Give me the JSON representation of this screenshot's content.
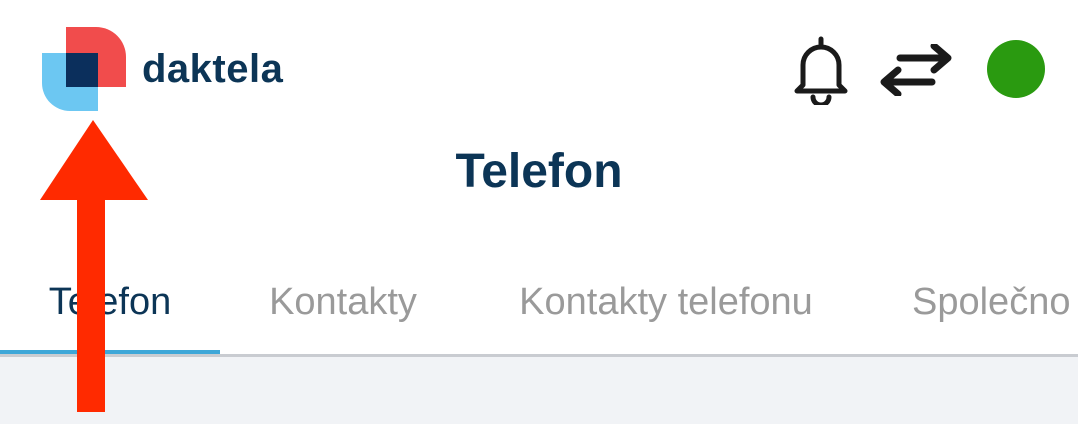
{
  "header": {
    "logo_text": "daktela",
    "icons": {
      "logo": "daktela-logo-icon",
      "notifications": "bell-icon",
      "switch": "swap-arrows-icon",
      "status": "status-online-dot"
    }
  },
  "page": {
    "title": "Telefon"
  },
  "tabs": [
    {
      "label": "Telefon",
      "active": true
    },
    {
      "label": "Kontakty",
      "active": false
    },
    {
      "label": "Kontakty telefonu",
      "active": false
    },
    {
      "label": "Společno",
      "active": false
    }
  ],
  "annotation": {
    "type": "red-arrow-up"
  },
  "colors": {
    "brand_navy": "#0c3556",
    "logo_red": "#f14c4c",
    "logo_blue": "#6cc7f2",
    "logo_dark": "#0b2f5c",
    "tab_inactive": "#9a9a9a",
    "tab_underline": "#3ea7d8",
    "status_green": "#2a9a10",
    "icon_dark": "#1a1a1a",
    "content_bg": "#f1f3f6",
    "annotation_red": "#ff2a00"
  }
}
